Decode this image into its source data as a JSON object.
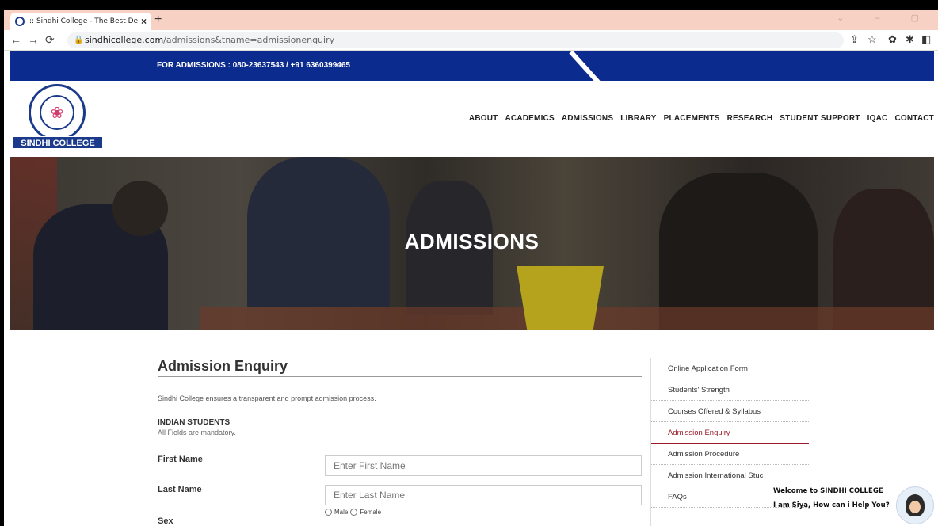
{
  "browser": {
    "tab_title": "Sindhi College - The Best Degre",
    "tab_title_prefix": "::",
    "tab_close": "×",
    "new_tab": "+",
    "url_host": "sindhicollege.com",
    "url_path": "/admissions&tname=admissionenquiry",
    "window_controls": "⌄ – ▢"
  },
  "site": {
    "phone_banner": "FOR ADMISSIONS : 080-23637543 / +91 6360399465",
    "logo_text": "SINDHI COLLEGE",
    "nav": [
      "ABOUT",
      "ACADEMICS",
      "ADMISSIONS",
      "LIBRARY",
      "PLACEMENTS",
      "RESEARCH",
      "STUDENT SUPPORT",
      "IQAC",
      "CONTACT"
    ],
    "hero_title": "ADMISSIONS"
  },
  "form": {
    "title": "Admission Enquiry",
    "intro": "Sindhi College ensures a transparent and prompt admission process.",
    "section_heading": "INDIAN STUDENTS",
    "section_note": "All Fields are mandatory.",
    "first_name_label": "First Name",
    "first_name_placeholder": "Enter First Name",
    "last_name_label": "Last Name",
    "last_name_placeholder": "Enter Last Name",
    "sex_label": "Sex",
    "sex_options": [
      "Male",
      "Female"
    ]
  },
  "sidebar": {
    "items": [
      "Online Application Form",
      "Students' Strength",
      "Courses Offered & Syllabus",
      "Admission Enquiry",
      "Admission Procedure",
      "Admission International Stuc",
      "FAQs"
    ],
    "active_index": 3
  },
  "chat": {
    "welcome": "Welcome  to SINDHI COLLEGE",
    "prompt": "I am Siya, How can i Help You?"
  },
  "colors": {
    "brand_blue": "#0c2b8f",
    "active_link": "#9b1b2a",
    "tab_bar": "#f7d2c4"
  }
}
